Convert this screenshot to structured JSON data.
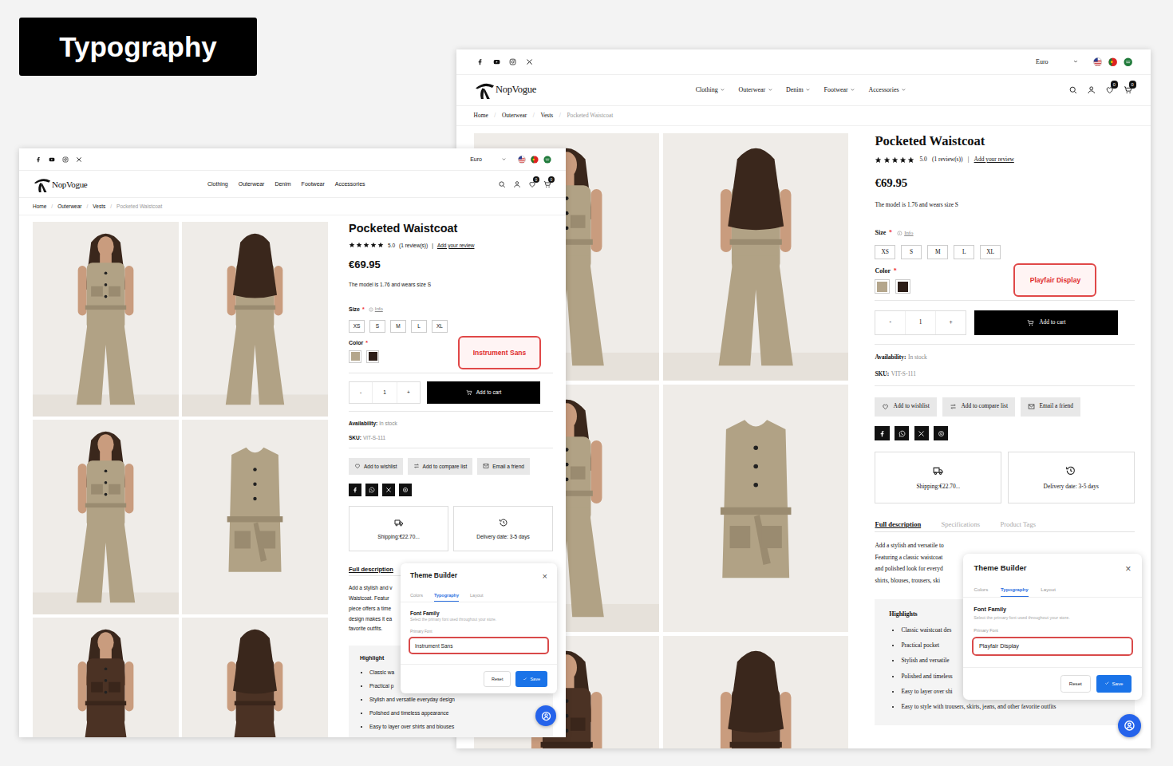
{
  "badge": "Typography",
  "screens": [
    {
      "kind": "sans",
      "callout": "Instrument Sans",
      "currency": "Euro",
      "logo": "NopVogue",
      "nav": [
        {
          "label": "Clothing",
          "dropdown": false
        },
        {
          "label": "Outerwear",
          "dropdown": false
        },
        {
          "label": "Denim",
          "dropdown": false
        },
        {
          "label": "Footwear",
          "dropdown": false
        },
        {
          "label": "Accessories",
          "dropdown": false
        }
      ],
      "wishlist_count": "0",
      "cart_count": "0",
      "breadcrumb": {
        "items": [
          "Home",
          "Outerwear",
          "Vests",
          "Pocketed Waistcoat"
        ],
        "separator": "/"
      },
      "product": {
        "title": "Pocketed Waistcoat",
        "stars": 5,
        "rating": "5.0",
        "reviews": "(1 review(s))",
        "divider": "|",
        "review_link": "Add your review",
        "price": "€69.95",
        "model_note": "The model is 1.76 and wears size S",
        "size_label": "Size",
        "required": "*",
        "info": "Info",
        "sizes": [
          "XS",
          "S",
          "M",
          "L",
          "XL"
        ],
        "color_label": "Color",
        "colors": [
          {
            "color": "#b4a68c"
          },
          {
            "color": "#2c1d17"
          }
        ],
        "minus": "-",
        "quantity": "1",
        "plus": "+",
        "add_to_cart": "Add to cart",
        "availability_label": "Availability:",
        "availability": "In stock",
        "sku_label": "SKU:",
        "sku": "VIT-S-111",
        "actions": [
          {
            "label": "Add to wishlist"
          },
          {
            "label": "Add to compare list"
          },
          {
            "label": "Email a friend"
          }
        ],
        "info_cards": [
          {
            "text": "Shipping:€22.70..."
          },
          {
            "text": "Delivery date: 3-5 days"
          }
        ]
      },
      "description": {
        "tabs": [
          {
            "label": "Full description",
            "selected": true
          }
        ],
        "lines": [
          "Add a stylish and v",
          "Waistcoat. Featur",
          "piece offers a time",
          "design makes it ea",
          "favorite outfits."
        ],
        "highlights_title": "Highlight",
        "highlights": [
          {
            "text": "Classic wa",
            "kind": "cut"
          },
          {
            "text": "Practical p",
            "kind": "cut"
          },
          {
            "text": "Stylish and versatile everyday design",
            "kind": "whole"
          },
          {
            "text": "Polished and timeless appearance",
            "kind": "whole"
          },
          {
            "text": "Easy to layer over shirts and blouses",
            "kind": "whole"
          }
        ]
      },
      "theme_builder": {
        "title": "Theme Builder",
        "close": "×",
        "tabs": [
          {
            "label": "Colors",
            "selected": false
          },
          {
            "label": "Typography",
            "selected": true
          },
          {
            "label": "Layout",
            "selected": false
          }
        ],
        "section": "Font Family",
        "hint": "Select the primary font used throughout your store.",
        "field_label": "Primary Font",
        "value": "Instrument Sans",
        "reset": "Reset",
        "save": "Save"
      }
    },
    {
      "kind": "serif",
      "callout": "Playfair Display",
      "currency": "Euro",
      "logo": "NopVogue",
      "nav": [
        {
          "label": "Clothing",
          "dropdown": true
        },
        {
          "label": "Outerwear",
          "dropdown": true
        },
        {
          "label": "Denim",
          "dropdown": true
        },
        {
          "label": "Footwear",
          "dropdown": true
        },
        {
          "label": "Accessories",
          "dropdown": true
        }
      ],
      "wishlist_count": "0",
      "cart_count": "0",
      "breadcrumb": {
        "items": [
          "Home",
          "Outerwear",
          "Vests",
          "Pocketed Waistcoat"
        ],
        "separator": "/"
      },
      "product": {
        "title": "Pocketed Waistcoat",
        "stars": 5,
        "rating": "5.0",
        "reviews": "(1 review(s))",
        "divider": "|",
        "review_link": "Add your review",
        "price": "€69.95",
        "model_note": "The model is 1.76 and wears size S",
        "size_label": "Size",
        "required": "*",
        "info": "Info",
        "sizes": [
          "XS",
          "S",
          "M",
          "L",
          "XL"
        ],
        "color_label": "Color",
        "colors": [
          {
            "color": "#b4a68c"
          },
          {
            "color": "#2c1d17"
          }
        ],
        "minus": "-",
        "quantity": "1",
        "plus": "+",
        "add_to_cart": "Add to cart",
        "availability_label": "Availability:",
        "availability": "In stock",
        "sku_label": "SKU:",
        "sku": "VIT-S-111",
        "actions": [
          {
            "label": "Add to wishlist"
          },
          {
            "label": "Add to compare list"
          },
          {
            "label": "Email a friend"
          }
        ],
        "info_cards": [
          {
            "text": "Shipping:€22.70..."
          },
          {
            "text": "Delivery date: 3-5 days"
          }
        ]
      },
      "description": {
        "tabs": [
          {
            "label": "Full description",
            "selected": true
          },
          {
            "label": "Specifications",
            "selected": false
          },
          {
            "label": "Product Tags",
            "selected": false
          }
        ],
        "lines": [
          "Add a stylish and versatile to",
          "Featuring a classic waistcoat",
          "and polished look for everyd",
          "shirts, blouses, trousers, ski"
        ],
        "highlights_title": "Highlights",
        "highlights": [
          {
            "text": "Classic waistcoat des",
            "kind": "cut"
          },
          {
            "text": "Practical pocket",
            "kind": "cut"
          },
          {
            "text": "Stylish and versatile",
            "kind": "cut"
          },
          {
            "text": "Polished and timeless",
            "kind": "cut"
          },
          {
            "text": "Easy to layer over shi",
            "kind": "cut"
          },
          {
            "text": "Easy to style with trousers, skirts, jeans, and other favorite outfits",
            "kind": "whole"
          }
        ]
      },
      "theme_builder": {
        "title": "Theme Builder",
        "close": "×",
        "tabs": [
          {
            "label": "Colors",
            "selected": false
          },
          {
            "label": "Typography",
            "selected": true
          },
          {
            "label": "Layout",
            "selected": false
          }
        ],
        "section": "Font Family",
        "hint": "Select the primary font used throughout your store.",
        "field_label": "Primary Font",
        "value": "Playfair Display",
        "reset": "Reset",
        "save": "Save"
      }
    }
  ]
}
